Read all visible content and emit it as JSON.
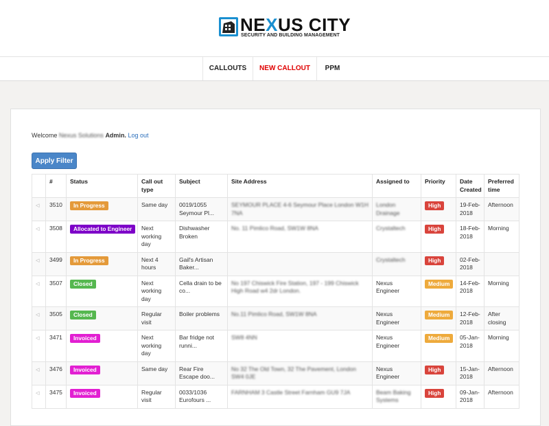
{
  "brand": {
    "name_start": "NE",
    "name_x": "X",
    "name_end": "US CITY",
    "tagline": "SECURITY AND BUILDING MANAGEMENT"
  },
  "nav": {
    "callouts": "CALLOUTS",
    "new_callout": "NEW CALLOUT",
    "ppm": "PPM"
  },
  "welcome": {
    "prefix": "Welcome",
    "company": "Nexus Solutions",
    "role": "Admin.",
    "logout": "Log out"
  },
  "filter_button": "Apply Filter",
  "table": {
    "headers": [
      "",
      "#",
      "Status",
      "Call out type",
      "Subject",
      "Site Address",
      "Assigned to",
      "Priority",
      "Date Created",
      "Preferred time"
    ],
    "rows": [
      {
        "id": "3510",
        "status": "In Progress",
        "type": "Same day",
        "subject": "0019/1055 Seymour Pl...",
        "address": "SEYMOUR PLACE 4-6 Seymour Place London W1H 7NA",
        "assigned": "London Drainage",
        "priority": "High",
        "date": "19-Feb-2018",
        "time": "Afternoon"
      },
      {
        "id": "3508",
        "status": "Allocated to Engineer",
        "type": "Next working day",
        "subject": "Dishwasher Broken",
        "address": "No. 11 Pimlico Road, SW1W 8NA",
        "assigned": "Crystaltech",
        "priority": "High",
        "date": "18-Feb-2018",
        "time": "Morning"
      },
      {
        "id": "3499",
        "status": "In Progress",
        "type": "Next 4 hours",
        "subject": "Gail's Artisan Baker...",
        "address": "",
        "assigned": "Crystaltech",
        "priority": "High",
        "date": "02-Feb-2018",
        "time": ""
      },
      {
        "id": "3507",
        "status": "Closed",
        "type": "Next working day",
        "subject": "Cella drain to be co...",
        "address": "No 197 Chiswick Fire Station, 197 - 199 Chiswick High Road w4 2dr London.",
        "assigned": "Nexus Engineer",
        "priority": "Medium",
        "date": "14-Feb-2018",
        "time": "Morning"
      },
      {
        "id": "3505",
        "status": "Closed",
        "type": "Regular visit",
        "subject": "Boiler problems",
        "address": "No.11 Pimlico Road, SW1W 8NA",
        "assigned": "Nexus Engineer",
        "priority": "Medium",
        "date": "12-Feb-2018",
        "time": "After closing"
      },
      {
        "id": "3471",
        "status": "Invoiced",
        "type": "Next working day",
        "subject": "Bar fridge not runni...",
        "address": "SW8 4NN",
        "assigned": "Nexus Engineer",
        "priority": "Medium",
        "date": "05-Jan-2018",
        "time": "Morning"
      },
      {
        "id": "3476",
        "status": "Invoiced",
        "type": "Same day",
        "subject": "Rear Fire Escape doo...",
        "address": "No 32 The Old Town, 32 The Pavement, London SW4 0JE",
        "assigned": "Nexus Engineer",
        "priority": "High",
        "date": "15-Jan-2018",
        "time": "Afternoon"
      },
      {
        "id": "3475",
        "status": "Invoiced",
        "type": "Regular visit",
        "subject": "0033/1036 Eurofours ...",
        "address": "FARNHAM 3 Castle Street Farnham GU9 7JA",
        "assigned": "Beam Baking Systems",
        "priority": "High",
        "date": "09-Jan-2018",
        "time": "Afternoon"
      }
    ],
    "blurred_assignees": [
      "London Drainage",
      "Crystaltech",
      "Beam Baking Systems"
    ]
  },
  "colors": {
    "In Progress": "#e49a3a",
    "Allocated to Engineer": "#7d00c8",
    "Closed": "#55b74f",
    "Invoiced": "#e21fd2",
    "High": "#d9443c",
    "Medium": "#eeaa3c",
    "brand_accent": "#1a8fd0",
    "nav_active": "#e00000",
    "button": "#4a86c8"
  }
}
